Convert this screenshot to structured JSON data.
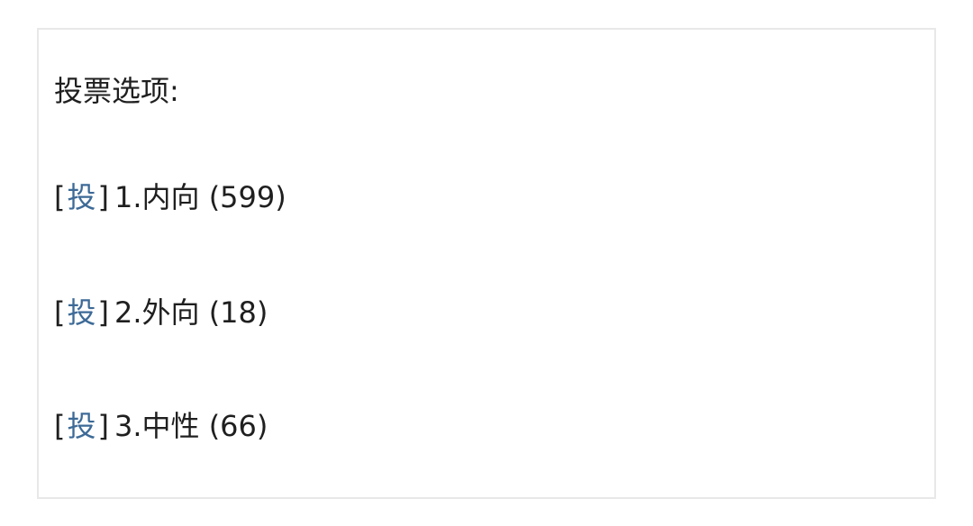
{
  "poll": {
    "title": "投票选项:",
    "vote_label": "投",
    "bracket_open": "[",
    "bracket_close": "]",
    "options": [
      {
        "text": "1.内向 (599)",
        "number": 1,
        "label": "内向",
        "votes": 599
      },
      {
        "text": "2.外向 (18)",
        "number": 2,
        "label": "外向",
        "votes": 18
      },
      {
        "text": "3.中性 (66)",
        "number": 3,
        "label": "中性",
        "votes": 66
      }
    ]
  },
  "colors": {
    "link": "#3d6a97",
    "text": "#1f1f1f",
    "border": "#e8e8e8"
  }
}
